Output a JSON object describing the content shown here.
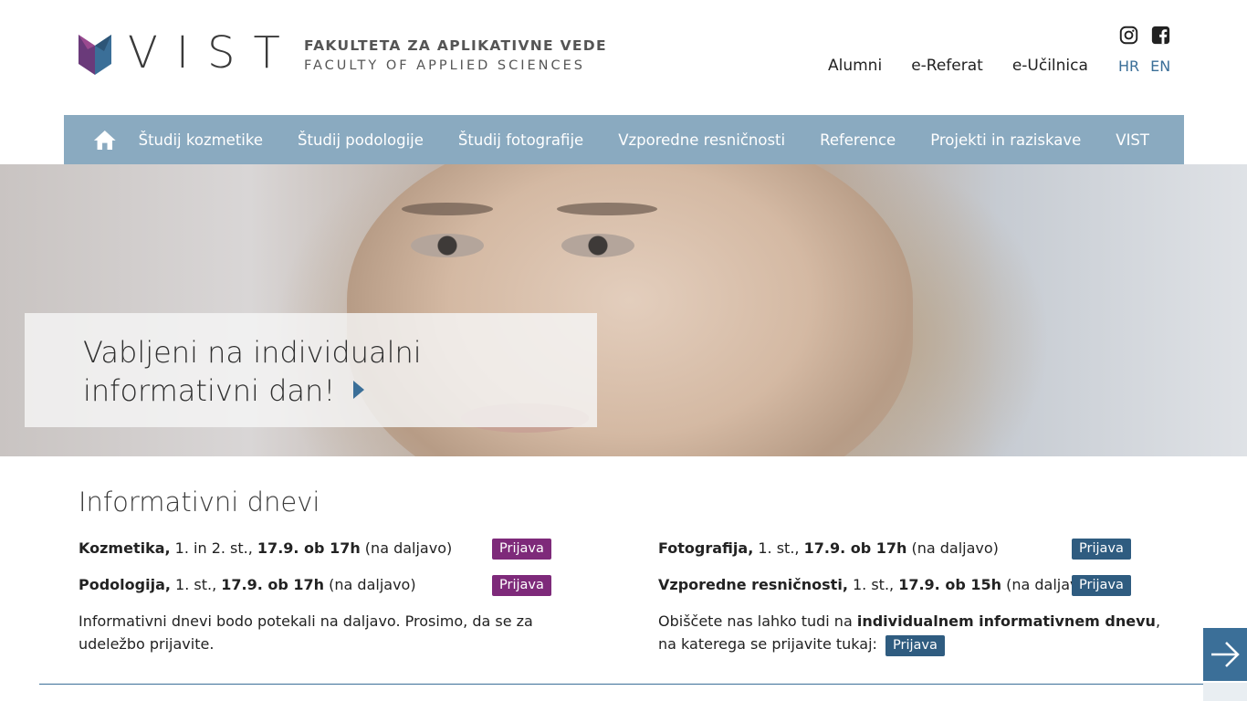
{
  "header": {
    "brand": "VIST",
    "tagline_sl": "FAKULTETA ZA APLIKATIVNE VEDE",
    "tagline_en": "FACULTY OF APPLIED SCIENCES",
    "links": [
      "Alumni",
      "e-Referat",
      "e-Učilnica"
    ],
    "languages": [
      "HR",
      "EN"
    ],
    "social_icons": [
      "instagram-icon",
      "facebook-icon"
    ]
  },
  "nav": {
    "home_icon": "home-icon",
    "items": [
      "Študij kozmetike",
      "Študij podologije",
      "Študij fotografije",
      "Vzporedne resničnosti",
      "Reference",
      "Projekti in raziskave",
      "VIST"
    ]
  },
  "hero": {
    "line1": "Vabljeni na individualni",
    "line2": "informativni dan!"
  },
  "info": {
    "title": "Informativni dnevi",
    "left": [
      {
        "program": "Kozmetika,",
        "level": " 1. in 2. st., ",
        "when": "17.9. ob 17h",
        "mode": " (na daljavo)",
        "button": "Prijava"
      },
      {
        "program": "Podologija,",
        "level": " 1. st., ",
        "when": "17.9. ob 17h",
        "mode": " (na daljavo)",
        "button": "Prijava"
      }
    ],
    "right": [
      {
        "program": "Fotografija,",
        "level": " 1. st., ",
        "when": "17.9. ob 17h",
        "mode": " (na daljavo)",
        "button": "Prijava"
      },
      {
        "program": "Vzporedne resničnosti,",
        "level": " 1. st., ",
        "when": "17.9. ob 15h",
        "mode": " (na daljavo)",
        "button": "Prijava"
      }
    ],
    "note_left": "Informativni dnevi bodo potekali na daljavo. Prosimo, da se za udeležbo prijavite.",
    "note_right_pre": "Obiščete nas lahko tudi na ",
    "note_right_bold": "individualnem informativnem dnevu",
    "note_right_post": ", na katerega se prijavite tukaj:",
    "note_right_button": "Prijava"
  },
  "colors": {
    "nav_bg": "#8aaac0",
    "accent_blue": "#2f5c80",
    "accent_purple": "#7e2a7a"
  }
}
